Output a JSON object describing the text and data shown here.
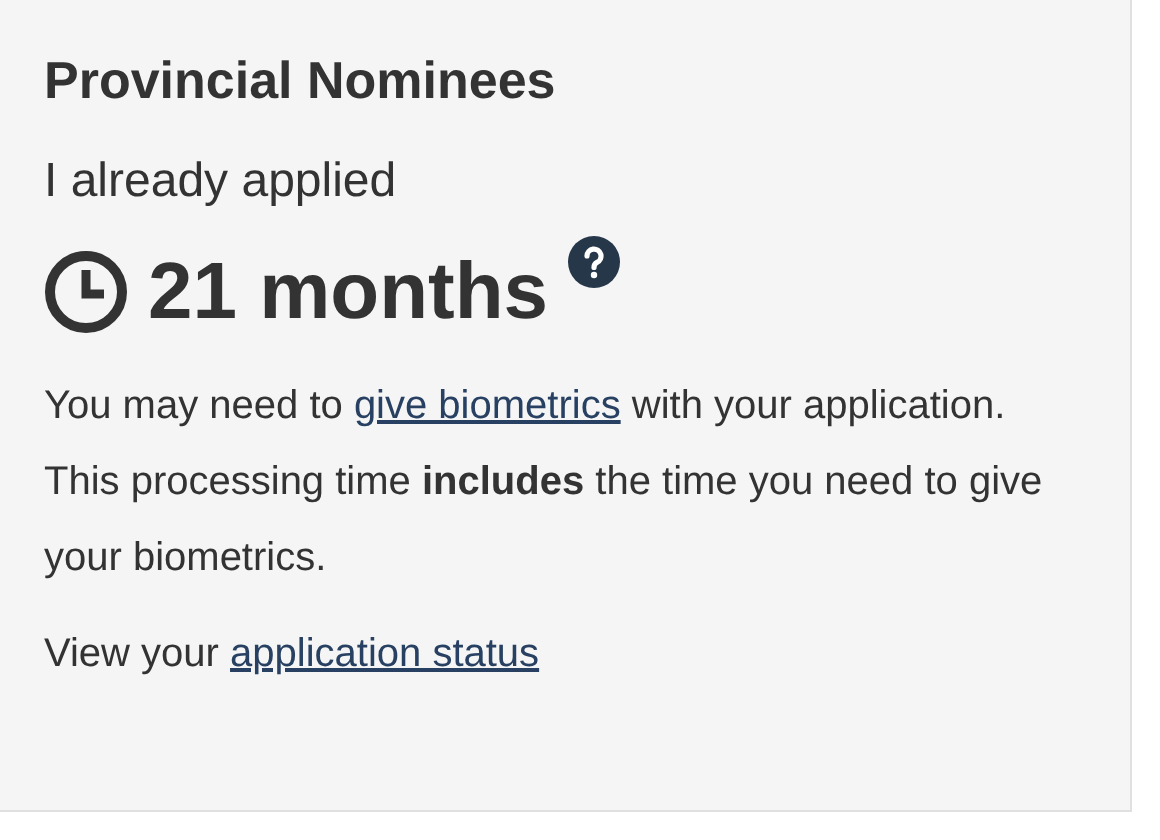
{
  "title": "Provincial Nominees",
  "subtitle": "I already applied",
  "processing_time": "21 months",
  "description": {
    "before": "You may need to ",
    "link": "give biometrics",
    "after": " with your application. This processing time **includes** the time you need to give your biometrics."
  },
  "status_line": {
    "before": "View your ",
    "link": "application status"
  }
}
